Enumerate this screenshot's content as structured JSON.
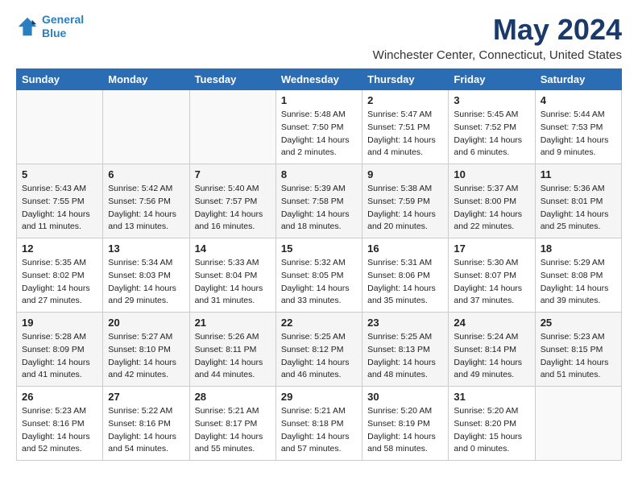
{
  "header": {
    "logo_line1": "General",
    "logo_line2": "Blue",
    "month_year": "May 2024",
    "location": "Winchester Center, Connecticut, United States"
  },
  "days_of_week": [
    "Sunday",
    "Monday",
    "Tuesday",
    "Wednesday",
    "Thursday",
    "Friday",
    "Saturday"
  ],
  "weeks": [
    [
      {
        "day": "",
        "info": ""
      },
      {
        "day": "",
        "info": ""
      },
      {
        "day": "",
        "info": ""
      },
      {
        "day": "1",
        "info": "Sunrise: 5:48 AM\nSunset: 7:50 PM\nDaylight: 14 hours\nand 2 minutes."
      },
      {
        "day": "2",
        "info": "Sunrise: 5:47 AM\nSunset: 7:51 PM\nDaylight: 14 hours\nand 4 minutes."
      },
      {
        "day": "3",
        "info": "Sunrise: 5:45 AM\nSunset: 7:52 PM\nDaylight: 14 hours\nand 6 minutes."
      },
      {
        "day": "4",
        "info": "Sunrise: 5:44 AM\nSunset: 7:53 PM\nDaylight: 14 hours\nand 9 minutes."
      }
    ],
    [
      {
        "day": "5",
        "info": "Sunrise: 5:43 AM\nSunset: 7:55 PM\nDaylight: 14 hours\nand 11 minutes."
      },
      {
        "day": "6",
        "info": "Sunrise: 5:42 AM\nSunset: 7:56 PM\nDaylight: 14 hours\nand 13 minutes."
      },
      {
        "day": "7",
        "info": "Sunrise: 5:40 AM\nSunset: 7:57 PM\nDaylight: 14 hours\nand 16 minutes."
      },
      {
        "day": "8",
        "info": "Sunrise: 5:39 AM\nSunset: 7:58 PM\nDaylight: 14 hours\nand 18 minutes."
      },
      {
        "day": "9",
        "info": "Sunrise: 5:38 AM\nSunset: 7:59 PM\nDaylight: 14 hours\nand 20 minutes."
      },
      {
        "day": "10",
        "info": "Sunrise: 5:37 AM\nSunset: 8:00 PM\nDaylight: 14 hours\nand 22 minutes."
      },
      {
        "day": "11",
        "info": "Sunrise: 5:36 AM\nSunset: 8:01 PM\nDaylight: 14 hours\nand 25 minutes."
      }
    ],
    [
      {
        "day": "12",
        "info": "Sunrise: 5:35 AM\nSunset: 8:02 PM\nDaylight: 14 hours\nand 27 minutes."
      },
      {
        "day": "13",
        "info": "Sunrise: 5:34 AM\nSunset: 8:03 PM\nDaylight: 14 hours\nand 29 minutes."
      },
      {
        "day": "14",
        "info": "Sunrise: 5:33 AM\nSunset: 8:04 PM\nDaylight: 14 hours\nand 31 minutes."
      },
      {
        "day": "15",
        "info": "Sunrise: 5:32 AM\nSunset: 8:05 PM\nDaylight: 14 hours\nand 33 minutes."
      },
      {
        "day": "16",
        "info": "Sunrise: 5:31 AM\nSunset: 8:06 PM\nDaylight: 14 hours\nand 35 minutes."
      },
      {
        "day": "17",
        "info": "Sunrise: 5:30 AM\nSunset: 8:07 PM\nDaylight: 14 hours\nand 37 minutes."
      },
      {
        "day": "18",
        "info": "Sunrise: 5:29 AM\nSunset: 8:08 PM\nDaylight: 14 hours\nand 39 minutes."
      }
    ],
    [
      {
        "day": "19",
        "info": "Sunrise: 5:28 AM\nSunset: 8:09 PM\nDaylight: 14 hours\nand 41 minutes."
      },
      {
        "day": "20",
        "info": "Sunrise: 5:27 AM\nSunset: 8:10 PM\nDaylight: 14 hours\nand 42 minutes."
      },
      {
        "day": "21",
        "info": "Sunrise: 5:26 AM\nSunset: 8:11 PM\nDaylight: 14 hours\nand 44 minutes."
      },
      {
        "day": "22",
        "info": "Sunrise: 5:25 AM\nSunset: 8:12 PM\nDaylight: 14 hours\nand 46 minutes."
      },
      {
        "day": "23",
        "info": "Sunrise: 5:25 AM\nSunset: 8:13 PM\nDaylight: 14 hours\nand 48 minutes."
      },
      {
        "day": "24",
        "info": "Sunrise: 5:24 AM\nSunset: 8:14 PM\nDaylight: 14 hours\nand 49 minutes."
      },
      {
        "day": "25",
        "info": "Sunrise: 5:23 AM\nSunset: 8:15 PM\nDaylight: 14 hours\nand 51 minutes."
      }
    ],
    [
      {
        "day": "26",
        "info": "Sunrise: 5:23 AM\nSunset: 8:16 PM\nDaylight: 14 hours\nand 52 minutes."
      },
      {
        "day": "27",
        "info": "Sunrise: 5:22 AM\nSunset: 8:16 PM\nDaylight: 14 hours\nand 54 minutes."
      },
      {
        "day": "28",
        "info": "Sunrise: 5:21 AM\nSunset: 8:17 PM\nDaylight: 14 hours\nand 55 minutes."
      },
      {
        "day": "29",
        "info": "Sunrise: 5:21 AM\nSunset: 8:18 PM\nDaylight: 14 hours\nand 57 minutes."
      },
      {
        "day": "30",
        "info": "Sunrise: 5:20 AM\nSunset: 8:19 PM\nDaylight: 14 hours\nand 58 minutes."
      },
      {
        "day": "31",
        "info": "Sunrise: 5:20 AM\nSunset: 8:20 PM\nDaylight: 15 hours\nand 0 minutes."
      },
      {
        "day": "",
        "info": ""
      }
    ]
  ]
}
